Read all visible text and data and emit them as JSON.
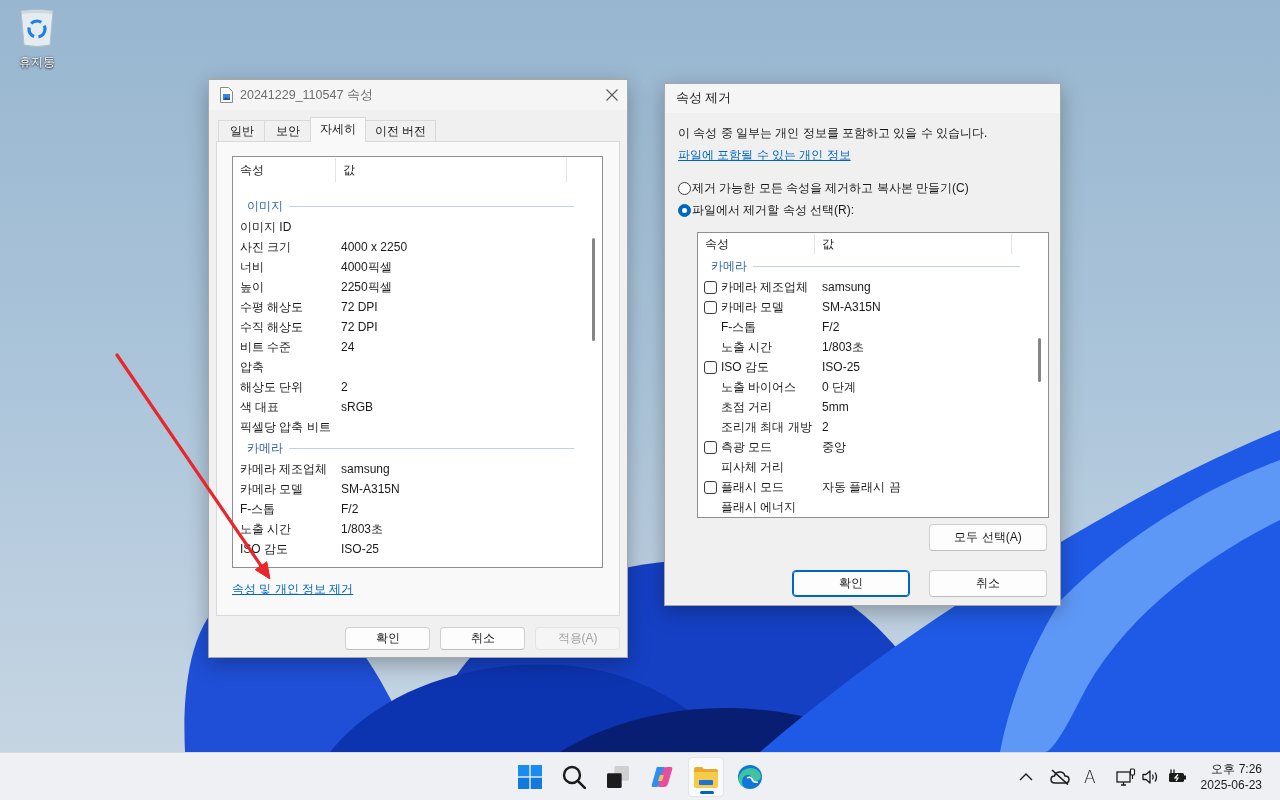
{
  "desktop": {
    "icons": [
      {
        "label": "휴지통"
      }
    ]
  },
  "properties_window": {
    "title": "20241229_110547 속성",
    "tabs": [
      {
        "label": "일반",
        "selected": false
      },
      {
        "label": "보안",
        "selected": false
      },
      {
        "label": "자세히",
        "selected": true
      },
      {
        "label": "이전 버전",
        "selected": false
      }
    ],
    "columns": [
      "속성",
      "값"
    ],
    "rows": [
      {
        "kind": "group",
        "name": "이미지"
      },
      {
        "kind": "item",
        "name": "이미지 ID"
      },
      {
        "kind": "item",
        "name": "사진 크기",
        "value": "4000 x 2250"
      },
      {
        "kind": "item",
        "name": "너비",
        "value": "4000픽셀"
      },
      {
        "kind": "item",
        "name": "높이",
        "value": "2250픽셀"
      },
      {
        "kind": "item",
        "name": "수평 해상도",
        "value": "72 DPI"
      },
      {
        "kind": "item",
        "name": "수직 해상도",
        "value": "72 DPI"
      },
      {
        "kind": "item",
        "name": "비트 수준",
        "value": "24"
      },
      {
        "kind": "item",
        "name": "압축"
      },
      {
        "kind": "item",
        "name": "해상도 단위",
        "value": "2"
      },
      {
        "kind": "item",
        "name": "색 대표",
        "value": "sRGB"
      },
      {
        "kind": "item",
        "name": "픽셀당 압축 비트"
      },
      {
        "kind": "group",
        "name": "카메라"
      },
      {
        "kind": "item",
        "name": "카메라 제조업체",
        "value": "samsung"
      },
      {
        "kind": "item",
        "name": "카메라 모델",
        "value": "SM-A315N"
      },
      {
        "kind": "item",
        "name": "F-스톱",
        "value": "F/2"
      },
      {
        "kind": "item",
        "name": "노출 시간",
        "value": "1/803초"
      },
      {
        "kind": "item",
        "name": "ISO 감도",
        "value": "ISO-25"
      }
    ],
    "link": "속성 및 개인 정보 제거",
    "buttons": [
      {
        "label": "확인",
        "disabled": false
      },
      {
        "label": "취소",
        "disabled": false
      },
      {
        "label": "적용(A)",
        "disabled": true
      }
    ]
  },
  "remove_dialog": {
    "title": "속성 제거",
    "message": "이 속성 중 일부는 개인 정보를 포함하고 있을 수 있습니다.",
    "link": "파일에 포함될 수 있는 개인 정보",
    "options": [
      {
        "label": "제거 가능한 모든 속성을 제거하고 복사본 만들기(C)",
        "selected": false
      },
      {
        "label": "파일에서 제거할 속성 선택(R):",
        "selected": true
      }
    ],
    "columns": [
      "속성",
      "값"
    ],
    "rows": [
      {
        "kind": "group",
        "name": "카메라"
      },
      {
        "kind": "checkbox",
        "name": "카메라 제조업체",
        "value": "samsung",
        "checked": false
      },
      {
        "kind": "checkbox",
        "name": "카메라 모델",
        "value": "SM-A315N",
        "checked": false
      },
      {
        "kind": "item",
        "name": "F-스톱",
        "value": "F/2"
      },
      {
        "kind": "item",
        "name": "노출 시간",
        "value": "1/803초"
      },
      {
        "kind": "checkbox",
        "name": "ISO 감도",
        "value": "ISO-25",
        "checked": false
      },
      {
        "kind": "item",
        "name": "노출 바이어스",
        "value": "0 단계"
      },
      {
        "kind": "item",
        "name": "초점 거리",
        "value": "5mm"
      },
      {
        "kind": "item",
        "name": "조리개 최대 개방",
        "value": "2"
      },
      {
        "kind": "checkbox",
        "name": "측광 모드",
        "value": "중앙",
        "checked": false
      },
      {
        "kind": "item",
        "name": "피사체 거리"
      },
      {
        "kind": "checkbox",
        "name": "플래시 모드",
        "value": "자동 플래시 끔",
        "checked": false
      },
      {
        "kind": "item",
        "name": "플래시 에너지"
      }
    ],
    "select_all_button": "모두 선택(A)",
    "buttons": [
      {
        "label": "확인",
        "default": true
      },
      {
        "label": "취소",
        "default": false
      }
    ]
  },
  "taskbar": {
    "apps": [
      {
        "kind": "start",
        "active": false
      },
      {
        "kind": "search",
        "active": false
      },
      {
        "kind": "task_view",
        "active": false
      },
      {
        "kind": "assistant",
        "active": false
      },
      {
        "kind": "files",
        "active": true
      },
      {
        "kind": "browser",
        "active": false
      }
    ],
    "ime_indicator": "A",
    "time": "오후 7:26",
    "date": "2025-06-23"
  }
}
